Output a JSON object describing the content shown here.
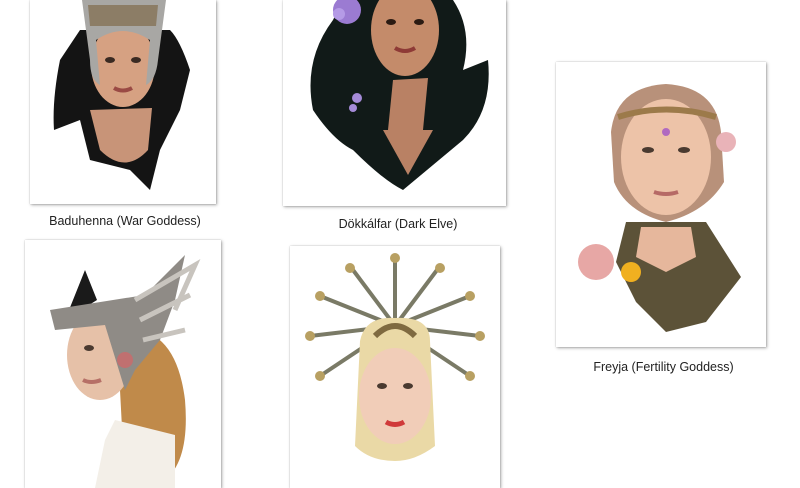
{
  "items": [
    {
      "name": "Baduhenna (War Goddess)",
      "icon": "war-goddess-portrait-image"
    },
    {
      "name": "Dökkálfar (Dark Elve)",
      "icon": "dark-elf-portrait-image"
    },
    {
      "name": "Freyja (Fertility Goddess)",
      "icon": "fertility-goddess-portrait-image"
    },
    {
      "name": "",
      "icon": "winged-helmet-portrait-image"
    },
    {
      "name": "",
      "icon": "golden-crown-portrait-image"
    }
  ]
}
